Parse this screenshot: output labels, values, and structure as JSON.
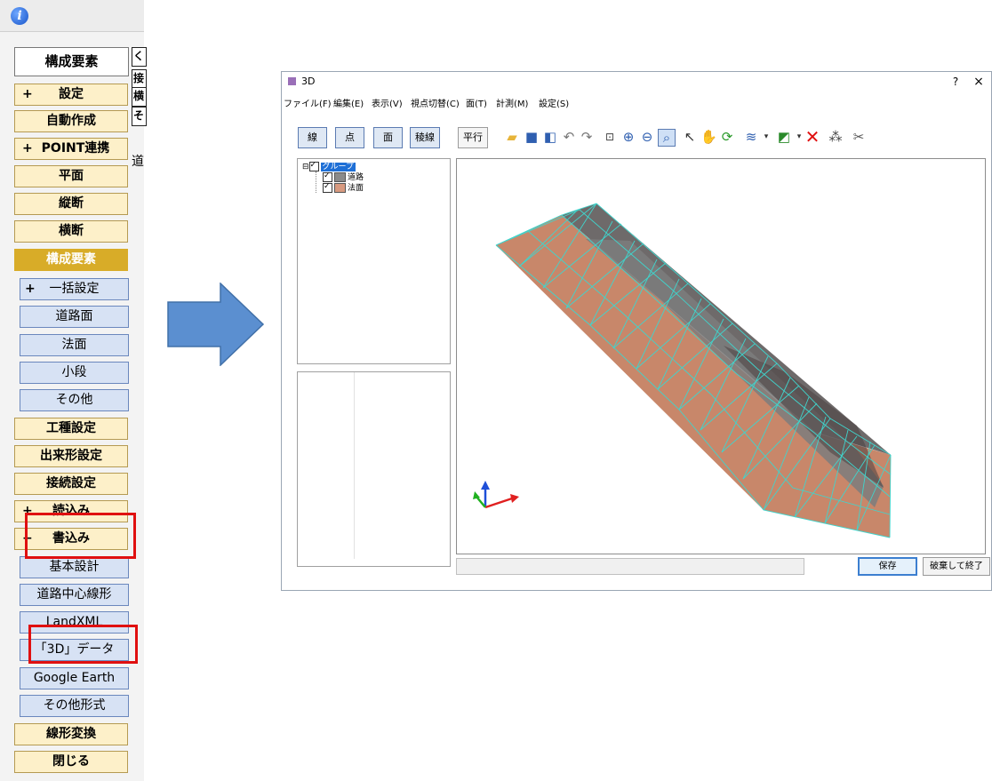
{
  "sidebar": {
    "active_tab": "構成要素",
    "strip_labels": [
      "く",
      "接",
      "横",
      "そ"
    ],
    "strip_text": "道",
    "items": [
      {
        "label": "設定",
        "sign": "+",
        "style": "tan"
      },
      {
        "label": "自動作成",
        "sign": "",
        "style": "tan"
      },
      {
        "label": "POINT連携",
        "sign": "+",
        "style": "tan"
      },
      {
        "label": "平面",
        "sign": "",
        "style": "tan"
      },
      {
        "label": "縦断",
        "sign": "",
        "style": "tan"
      },
      {
        "label": "横断",
        "sign": "",
        "style": "tan"
      },
      {
        "label": "構成要素",
        "sign": "",
        "style": "gold"
      },
      {
        "label": "一括設定",
        "sign": "+",
        "style": "blue"
      },
      {
        "label": "道路面",
        "sign": "",
        "style": "blue"
      },
      {
        "label": "法面",
        "sign": "",
        "style": "blue"
      },
      {
        "label": "小段",
        "sign": "",
        "style": "blue"
      },
      {
        "label": "その他",
        "sign": "",
        "style": "blue"
      },
      {
        "label": "工種設定",
        "sign": "",
        "style": "tan"
      },
      {
        "label": "出来形設定",
        "sign": "",
        "style": "tan"
      },
      {
        "label": "接続設定",
        "sign": "",
        "style": "tan"
      },
      {
        "label": "読込み",
        "sign": "+",
        "style": "tan"
      },
      {
        "label": "書込み",
        "sign": "−",
        "style": "tan"
      },
      {
        "label": "基本設計",
        "sign": "",
        "style": "blue"
      },
      {
        "label": "道路中心線形",
        "sign": "",
        "style": "blue"
      },
      {
        "label": "LandXML",
        "sign": "",
        "style": "blue"
      },
      {
        "label": "「3D」データ",
        "sign": "",
        "style": "blue"
      },
      {
        "label": "Google Earth",
        "sign": "",
        "style": "blue"
      },
      {
        "label": "その他形式",
        "sign": "",
        "style": "blue"
      },
      {
        "label": "線形変換",
        "sign": "",
        "style": "tan"
      },
      {
        "label": "閉じる",
        "sign": "",
        "style": "tan"
      }
    ]
  },
  "window": {
    "title": "3D",
    "help": "?",
    "close": "×",
    "menu": [
      "ファイル(F)",
      "編集(E)",
      "表示(V)",
      "視点切替(C)",
      "面(T)",
      "計測(M)",
      "設定(S)"
    ],
    "mode_buttons": [
      "線",
      "点",
      "面",
      "稜線"
    ],
    "parallel_button": "平行",
    "tree": {
      "root": "グループ",
      "root_toggle": "⊟",
      "children": [
        {
          "label": "道路",
          "color": "#8a8a8a"
        },
        {
          "label": "法面",
          "color": "#d89a80"
        }
      ]
    },
    "save_button": "保存",
    "discard_button": "破棄して終了"
  },
  "colors": {
    "arrow": "#5b8fd0",
    "highlight": "#e01010",
    "mesh_edge": "#40d4cc",
    "slope_face": "#c8876a",
    "road_face": "#7d7d7d",
    "dark_face": "#4a4040"
  }
}
